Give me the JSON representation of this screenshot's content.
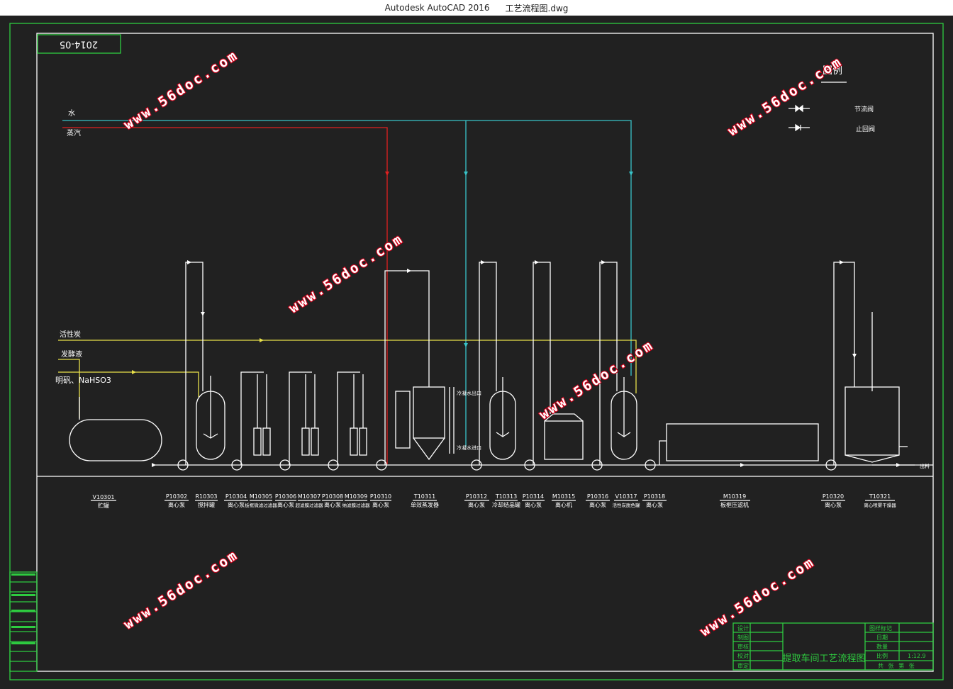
{
  "window": {
    "app_title": "Autodesk AutoCAD 2016",
    "file_name": "工艺流程图.dwg"
  },
  "drawing": {
    "date_stamp": "2014-05",
    "legend": {
      "title": "图例",
      "items": [
        {
          "symbol": "throttle-valve",
          "label": "节流阀"
        },
        {
          "symbol": "check-valve",
          "label": "止回阀"
        }
      ]
    },
    "utility_lines": [
      {
        "label": "水",
        "color": "#38c3c8"
      },
      {
        "label": "蒸汽",
        "color": "#e02020"
      },
      {
        "label": "活性炭",
        "color": "#e8e04a"
      },
      {
        "label": "发酵液",
        "color": "#e8e04a"
      },
      {
        "label": "明矾、NaHSO3",
        "color": "#e8e04a"
      }
    ],
    "side_labels": {
      "condensate_out": "冷凝水出口",
      "condensate_in": "冷凝水进口",
      "product_out": "出料"
    },
    "equipment": [
      {
        "tag": "V10301",
        "name": "贮罐"
      },
      {
        "tag": "P10302",
        "name": "离心泵"
      },
      {
        "tag": "R10303",
        "name": "搅拌罐"
      },
      {
        "tag": "P10304",
        "name": "离心泵"
      },
      {
        "tag": "M10305",
        "name": "板框微滤过滤器"
      },
      {
        "tag": "P10306",
        "name": "离心泵"
      },
      {
        "tag": "M10307",
        "name": "超滤膜过滤器"
      },
      {
        "tag": "P10308",
        "name": "离心泵"
      },
      {
        "tag": "M10309",
        "name": "纳滤膜过滤器"
      },
      {
        "tag": "P10310",
        "name": "离心泵"
      },
      {
        "tag": "T10311",
        "name": "单效蒸发器"
      },
      {
        "tag": "P10312",
        "name": "离心泵"
      },
      {
        "tag": "T10313",
        "name": "冷却结晶罐"
      },
      {
        "tag": "P10314",
        "name": "离心泵"
      },
      {
        "tag": "M10315",
        "name": "离心机"
      },
      {
        "tag": "P10316",
        "name": "离心泵"
      },
      {
        "tag": "V10317",
        "name": "活性炭脱色罐"
      },
      {
        "tag": "P10318",
        "name": "离心泵"
      },
      {
        "tag": "M10319",
        "name": "板框压滤机"
      },
      {
        "tag": "P10320",
        "name": "离心泵"
      },
      {
        "tag": "T10321",
        "name": "离心喷雾干燥器"
      }
    ],
    "title_block": {
      "left_rows": [
        "设计",
        "制图",
        "审核",
        "校对",
        "审定"
      ],
      "title": "提取车间工艺流程图",
      "right_rows": [
        {
          "label": "图样标记",
          "value": ""
        },
        {
          "label": "日期",
          "value": ""
        },
        {
          "label": "数量",
          "value": ""
        },
        {
          "label": "比例",
          "value": "1:12.9"
        },
        {
          "label": "共 张 第 张",
          "value": ""
        }
      ]
    },
    "watermark": "www.56doc.com"
  }
}
